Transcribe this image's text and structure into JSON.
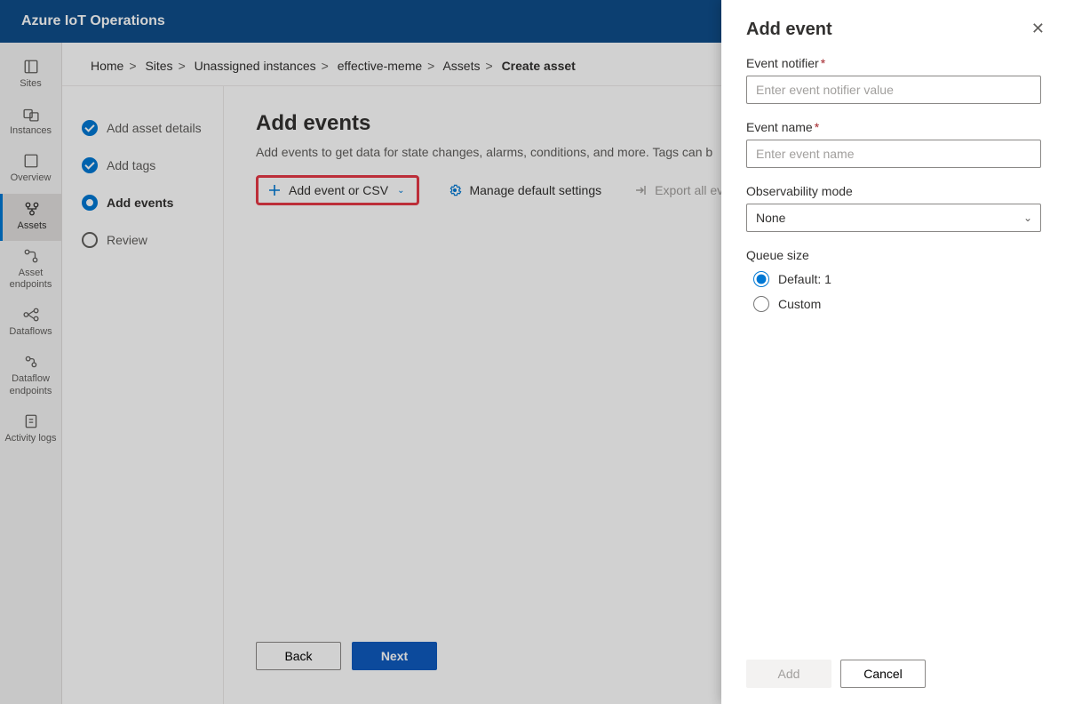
{
  "header": {
    "title": "Azure IoT Operations"
  },
  "rail": [
    {
      "label": "Sites"
    },
    {
      "label": "Instances"
    },
    {
      "label": "Overview"
    },
    {
      "label": "Assets",
      "active": true
    },
    {
      "label": "Asset endpoints"
    },
    {
      "label": "Dataflows"
    },
    {
      "label": "Dataflow endpoints"
    },
    {
      "label": "Activity logs"
    }
  ],
  "breadcrumb": {
    "items": [
      "Home",
      "Sites",
      "Unassigned instances",
      "effective-meme",
      "Assets"
    ],
    "current": "Create asset"
  },
  "steps": [
    {
      "label": "Add asset details",
      "state": "done"
    },
    {
      "label": "Add tags",
      "state": "done"
    },
    {
      "label": "Add events",
      "state": "current"
    },
    {
      "label": "Review",
      "state": "pending"
    }
  ],
  "wizard": {
    "title": "Add events",
    "desc": "Add events to get data for state changes, alarms, conditions, and more. Tags can b",
    "toolbar": {
      "add_label": "Add event or CSV",
      "manage_label": "Manage default settings",
      "export_label": "Export all events"
    },
    "back_label": "Back",
    "next_label": "Next"
  },
  "panel": {
    "title": "Add event",
    "notifier": {
      "label": "Event notifier",
      "placeholder": "Enter event notifier value"
    },
    "name": {
      "label": "Event name",
      "placeholder": "Enter event name"
    },
    "mode": {
      "label": "Observability mode",
      "value": "None"
    },
    "queue": {
      "label": "Queue size",
      "default_label": "Default: 1",
      "custom_label": "Custom"
    },
    "add_label": "Add",
    "cancel_label": "Cancel"
  }
}
